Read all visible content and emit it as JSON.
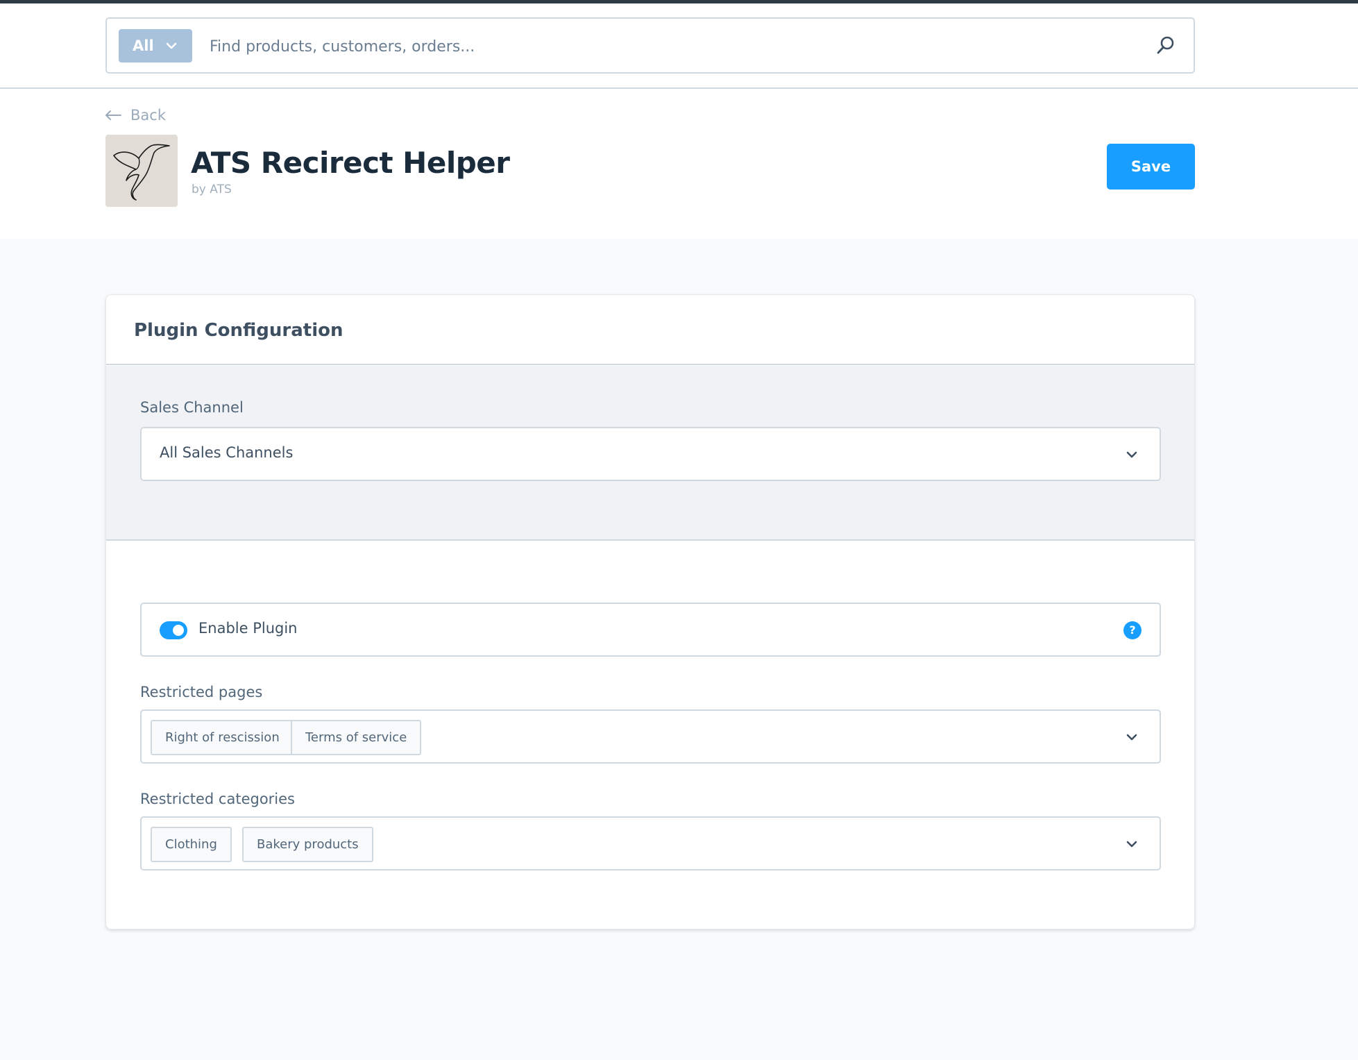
{
  "search": {
    "type_label": "All",
    "placeholder": "Find products, customers, orders..."
  },
  "nav": {
    "back_label": "Back"
  },
  "plugin": {
    "title": "ATS Recirect Helper",
    "author": "by ATS",
    "save_label": "Save"
  },
  "config": {
    "title": "Plugin Configuration",
    "sales_channel": {
      "label": "Sales Channel",
      "value": "All Sales Channels"
    },
    "enable_plugin": {
      "label": "Enable Plugin",
      "enabled": true,
      "help": "?"
    },
    "restricted_pages": {
      "label": "Restricted pages",
      "tags": [
        "Right of rescission",
        "Terms of service"
      ]
    },
    "restricted_categories": {
      "label": "Restricted categories",
      "tags": [
        "Clothing",
        "Bakery products"
      ]
    }
  },
  "colors": {
    "accent": "#189eff",
    "search_type_bg": "#a9c2dc",
    "text_dark": "#1a2b3c",
    "border": "#d1d9e0"
  },
  "icons": {
    "search": "search-icon",
    "back": "arrow-left-icon",
    "dropdown": "chevron-down-icon",
    "help": "help-icon",
    "logo": "hummingbird-logo"
  }
}
